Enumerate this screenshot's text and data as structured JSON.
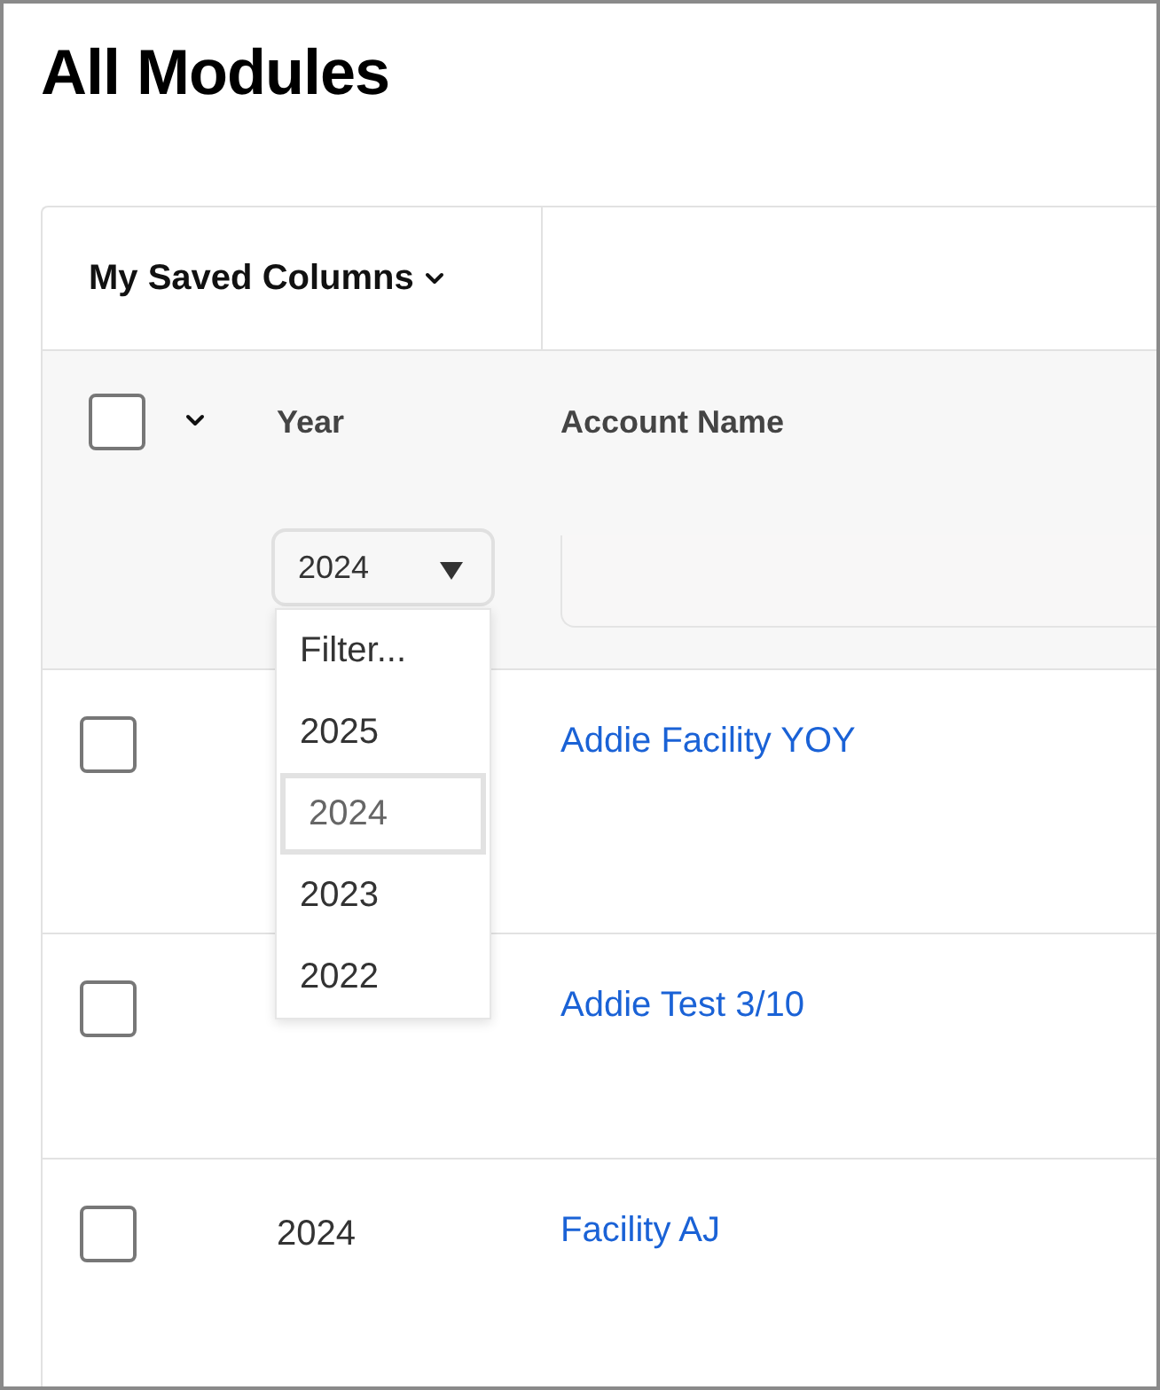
{
  "page": {
    "title": "All Modules"
  },
  "toolbar": {
    "saved_columns": "My Saved Columns"
  },
  "header": {
    "select_all_checked": false,
    "columns": [
      "Year",
      "Account Name"
    ],
    "year_filter": {
      "value": "2024",
      "expanded": true,
      "options": [
        {
          "label": "Filter...",
          "selected": false
        },
        {
          "label": "2025",
          "selected": false
        },
        {
          "label": "2024",
          "selected": true
        },
        {
          "label": "2023",
          "selected": false
        },
        {
          "label": "2022",
          "selected": false
        }
      ]
    }
  },
  "rows": [
    {
      "checked": false,
      "account_name": "Addie Facility YOY"
    },
    {
      "checked": false,
      "account_name": "Addie Test 3/10"
    },
    {
      "checked": false,
      "year": "2024",
      "account_name": "Facility AJ"
    }
  ]
}
